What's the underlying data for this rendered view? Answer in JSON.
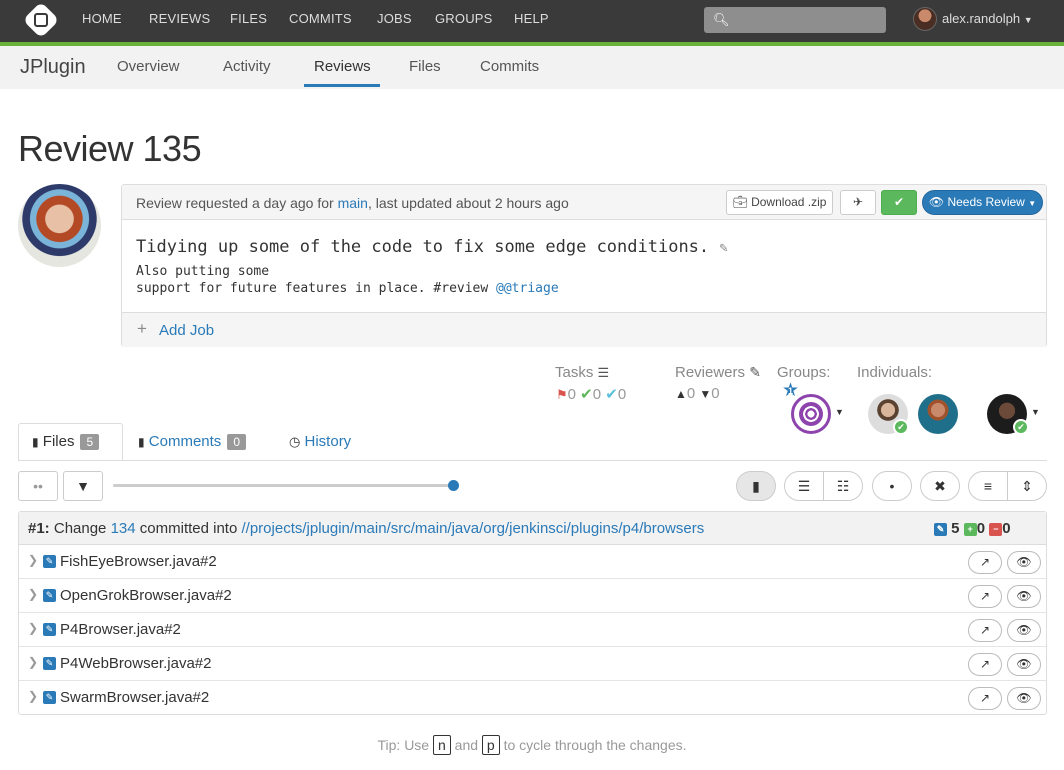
{
  "topnav": {
    "items": [
      "HOME",
      "REVIEWS",
      "FILES",
      "COMMITS",
      "JOBS",
      "GROUPS",
      "HELP"
    ],
    "user": "alex.randolph"
  },
  "subnav": {
    "project": "JPlugin",
    "tabs": [
      "Overview",
      "Activity",
      "Reviews",
      "Files",
      "Commits"
    ],
    "active_tab": "Reviews"
  },
  "page_title": "Review 135",
  "review": {
    "requested_text": "Review requested a day ago for",
    "branch": "main",
    "updated_text": ", last updated about 2 hours ago",
    "download_label": "Download .zip",
    "status_label": "Needs Review",
    "desc_title": "Tidying up some of the code to fix some edge conditions.",
    "desc_line1": "Also putting some",
    "desc_line2": "support for future features in place. #review",
    "desc_mention": "@@triage",
    "add_job_label": "Add Job"
  },
  "meta": {
    "tasks_label": "Tasks",
    "tasks_counts": [
      "0",
      "0",
      "0"
    ],
    "reviewers_label": "Reviewers",
    "reviewers_counts": [
      "0",
      "0"
    ],
    "groups_label": "Groups:",
    "groups_badge": "1",
    "individuals_label": "Individuals:"
  },
  "tabs": {
    "files_label": "Files",
    "files_count": "5",
    "comments_label": "Comments",
    "comments_count": "0",
    "history_label": "History"
  },
  "change": {
    "number": "#1:",
    "text_before": "Change",
    "change_id": "134",
    "text_mid": "committed into",
    "path": "//projects/jplugin/main/src/main/java/org/jenkinsci/plugins/p4/browsers",
    "edited": "5",
    "added": "0",
    "deleted": "0",
    "files": [
      "FishEyeBrowser.java#2",
      "OpenGrokBrowser.java#2",
      "P4Browser.java#2",
      "P4WebBrowser.java#2",
      "SwarmBrowser.java#2"
    ]
  },
  "tip": {
    "prefix": "Tip: Use",
    "key1": "n",
    "and": "and",
    "key2": "p",
    "suffix": "to cycle through the changes."
  },
  "colors": {
    "accent_blue": "#2a7ab8",
    "nav_green": "#69b23a",
    "topbar": "#3a3a3a"
  }
}
